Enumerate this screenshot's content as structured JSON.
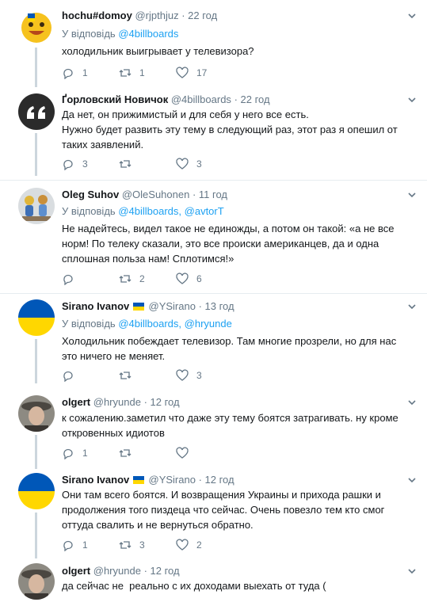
{
  "tweets": [
    {
      "name": "hochu#domoy",
      "flag": false,
      "handle": "@rjpthjuz",
      "time": "· 22 год",
      "reply_prefix": "У відповідь",
      "reply_to": "@4billboards",
      "reply_sep": "",
      "reply_to2": "",
      "text": "холодильник выигрывает у телевизора?",
      "counts": {
        "reply": "1",
        "retweet": "1",
        "like": "17"
      },
      "avatar": "emoji-face"
    },
    {
      "name": "Ґорловский Новичок",
      "flag": false,
      "handle": "@4billboards",
      "time": "· 22 год",
      "reply_prefix": "",
      "reply_to": "",
      "reply_sep": "",
      "reply_to2": "",
      "text": "Да нет, он прижимистый и для себя у него все есть.\nНужно будет развить эту тему в следующий раз, этот раз я опешил от таких заявлений.",
      "counts": {
        "reply": "3",
        "retweet": "",
        "like": "3"
      },
      "avatar": "quote-mark"
    },
    {
      "name": "Oleg Suhov",
      "flag": false,
      "handle": "@OleSuhonen",
      "time": "· 11 год",
      "reply_prefix": "У відповідь",
      "reply_to": "@4billboards",
      "reply_sep": ",",
      "reply_to2": "@avtorT",
      "text": "Не надейтесь, видел такое не единожды, а потом он такой: «а не все норм! По телеку сказали, это все происки американцев, да и одна сплошная польза нам! Сплотимся!»",
      "counts": {
        "reply": "",
        "retweet": "2",
        "like": "6"
      },
      "avatar": "figurines"
    },
    {
      "name": "Sirano Ivanov",
      "flag": true,
      "handle": "@YSirano",
      "time": "· 13 год",
      "reply_prefix": "У відповідь",
      "reply_to": "@4billboards",
      "reply_sep": ",",
      "reply_to2": "@hryunde",
      "text": "Холодильник побеждает телевизор. Там многие прозрели, но для нас это ничего не меняет.",
      "counts": {
        "reply": "",
        "retweet": "",
        "like": "3"
      },
      "avatar": "ukraine-flag"
    },
    {
      "name": "olgert",
      "flag": false,
      "handle": "@hryunde",
      "time": "· 12 год",
      "reply_prefix": "",
      "reply_to": "",
      "reply_sep": "",
      "reply_to2": "",
      "text": "к сожалению.заметил что даже эту тему боятся затрагивать. ну кроме откровенных идиотов",
      "counts": {
        "reply": "1",
        "retweet": "",
        "like": ""
      },
      "avatar": "photo-man"
    },
    {
      "name": "Sirano Ivanov",
      "flag": true,
      "handle": "@YSirano",
      "time": "· 12 год",
      "reply_prefix": "",
      "reply_to": "",
      "reply_sep": "",
      "reply_to2": "",
      "text": "Они там всего боятся. И возвращения Украины и прихода рашки и продолжения того пиздеца что сейчас. Очень повезло тем кто смог оттуда свалить и не вернуться обратно.",
      "counts": {
        "reply": "1",
        "retweet": "3",
        "like": "2"
      },
      "avatar": "ukraine-flag"
    },
    {
      "name": "olgert",
      "flag": false,
      "handle": "@hryunde",
      "time": "· 12 год",
      "reply_prefix": "",
      "reply_to": "",
      "reply_sep": "",
      "reply_to2": "",
      "text": "да сейчас не  реально с их доходами выехать от туда (",
      "counts": {
        "reply": "",
        "retweet": "",
        "like": ""
      },
      "avatar": "photo-man"
    }
  ]
}
